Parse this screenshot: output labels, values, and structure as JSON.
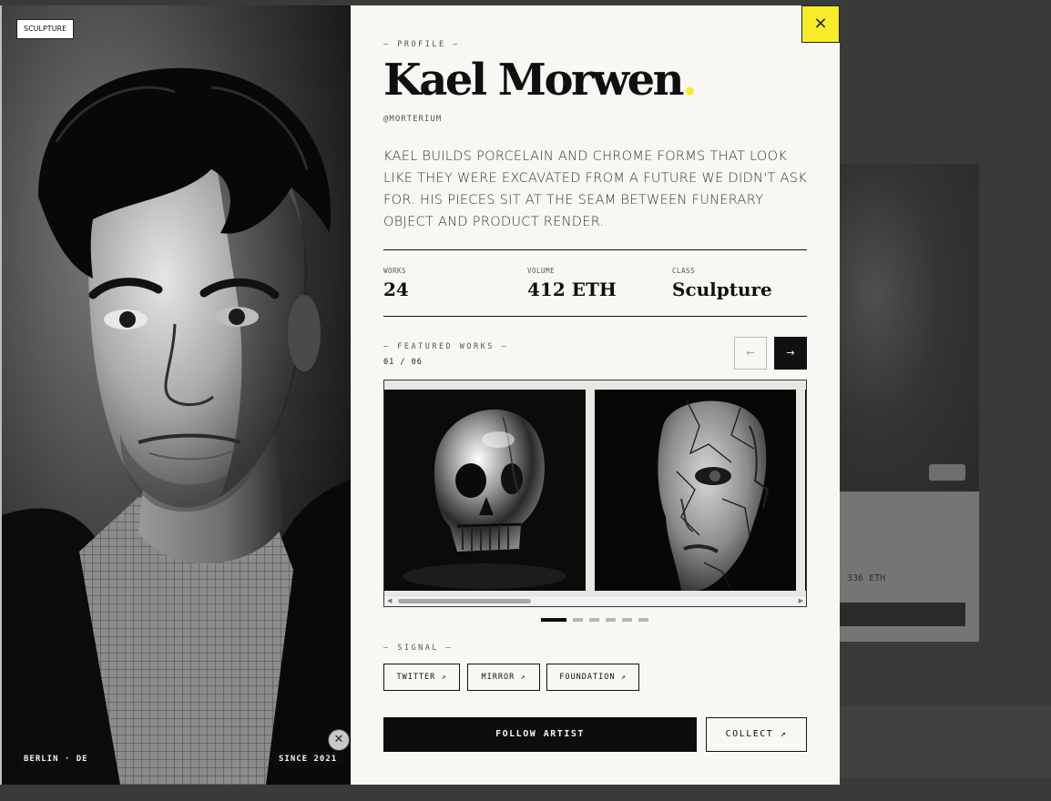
{
  "portrait": {
    "tag": "SCULPTURE",
    "location": "BERLIN · DE",
    "since": "SINCE 2021"
  },
  "close_icon": "×",
  "profile": {
    "kicker": "— PROFILE —",
    "name": "Kael Morwen",
    "name_dot": ".",
    "handle": "@MORTERIUM",
    "bio": "Kael builds porcelain and chrome forms that look like they were excavated from a future we didn't ask for. His pieces sit at the seam between funerary object and product render."
  },
  "stats": [
    {
      "label": "WORKS",
      "value": "24"
    },
    {
      "label": "VOLUME",
      "value": "412 ETH"
    },
    {
      "label": "CLASS",
      "value": "Sculpture"
    }
  ],
  "featured": {
    "kicker": "— FEATURED WORKS —",
    "counter": "01 / 06",
    "prev_icon": "←",
    "next_icon": "→",
    "active_index": 0,
    "total": 6
  },
  "signal": {
    "kicker": "— SIGNAL —",
    "links": [
      "TWITTER ↗",
      "MIRROR ↗",
      "FOUNDATION ↗"
    ]
  },
  "actions": {
    "follow": "FOLLOW ARTIST",
    "collect": "COLLECT ↗"
  },
  "background": {
    "card_text": "336 ETH"
  },
  "colors": {
    "accent": "#f7ec27",
    "ink": "#0d0d0d",
    "paper": "#f8f7f3",
    "backdrop": "#3a3a38"
  }
}
